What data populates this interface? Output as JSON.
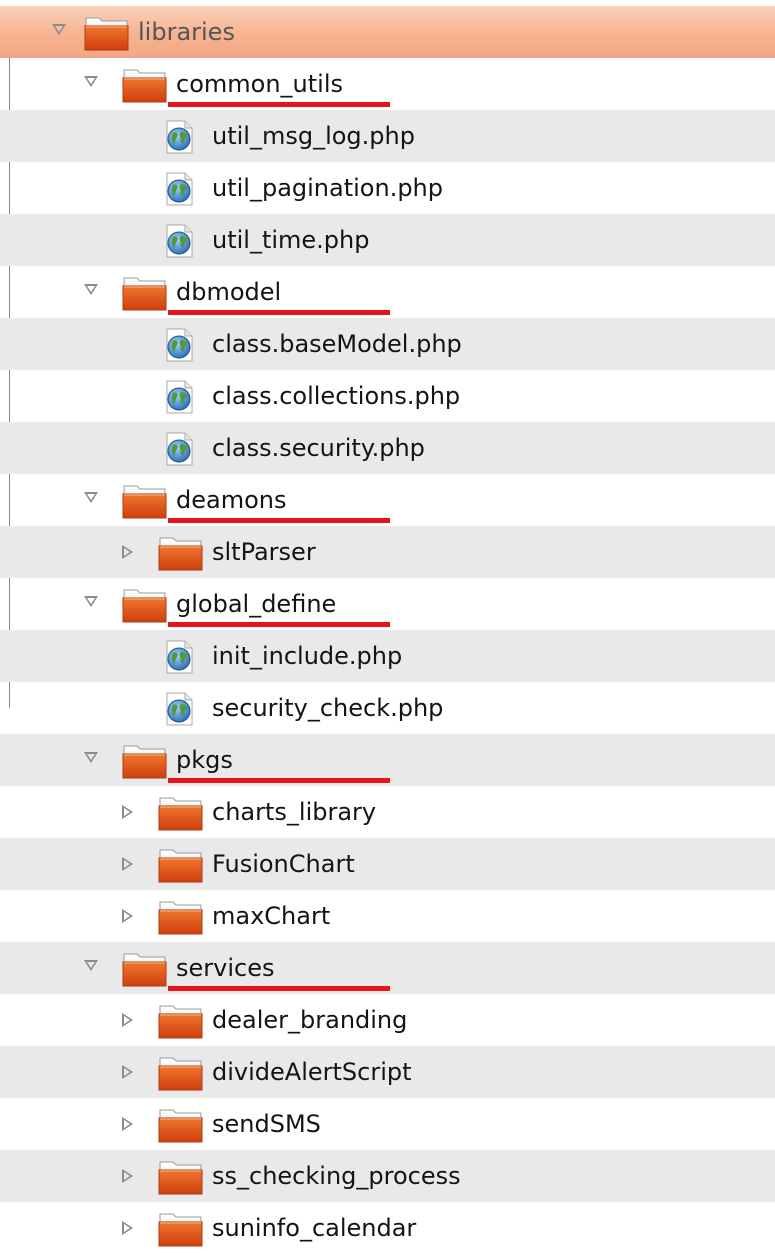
{
  "tree": [
    {
      "label": "libraries",
      "type": "folder",
      "level": 0,
      "expanded": true,
      "selected": true
    },
    {
      "label": "common_utils",
      "type": "folder",
      "level": 1,
      "expanded": true,
      "underlined": true
    },
    {
      "label": "util_msg_log.php",
      "type": "file",
      "level": 2
    },
    {
      "label": "util_pagination.php",
      "type": "file",
      "level": 2
    },
    {
      "label": "util_time.php",
      "type": "file",
      "level": 2
    },
    {
      "label": "dbmodel",
      "type": "folder",
      "level": 1,
      "expanded": true,
      "underlined": true
    },
    {
      "label": "class.baseModel.php",
      "type": "file",
      "level": 2
    },
    {
      "label": "class.collections.php",
      "type": "file",
      "level": 2
    },
    {
      "label": "class.security.php",
      "type": "file",
      "level": 2
    },
    {
      "label": "deamons",
      "type": "folder",
      "level": 1,
      "expanded": true,
      "underlined": true
    },
    {
      "label": "sltParser",
      "type": "folder",
      "level": 2,
      "expanded": false
    },
    {
      "label": "global_define",
      "type": "folder",
      "level": 1,
      "expanded": true,
      "underlined": true
    },
    {
      "label": "init_include.php",
      "type": "file",
      "level": 2
    },
    {
      "label": "security_check.php",
      "type": "file",
      "level": 2
    },
    {
      "label": "pkgs",
      "type": "folder",
      "level": 1,
      "expanded": true,
      "underlined": true
    },
    {
      "label": "charts_library",
      "type": "folder",
      "level": 2,
      "expanded": false
    },
    {
      "label": "FusionChart",
      "type": "folder",
      "level": 2,
      "expanded": false
    },
    {
      "label": "maxChart",
      "type": "folder",
      "level": 2,
      "expanded": false
    },
    {
      "label": "services",
      "type": "folder",
      "level": 1,
      "expanded": true,
      "underlined": true
    },
    {
      "label": "dealer_branding",
      "type": "folder",
      "level": 2,
      "expanded": false
    },
    {
      "label": "divideAlertScript",
      "type": "folder",
      "level": 2,
      "expanded": false
    },
    {
      "label": "sendSMS",
      "type": "folder",
      "level": 2,
      "expanded": false
    },
    {
      "label": "ss_checking_process",
      "type": "folder",
      "level": 2,
      "expanded": false
    },
    {
      "label": "suninfo_calendar",
      "type": "folder",
      "level": 2,
      "expanded": false
    }
  ],
  "colors": {
    "selection": "#f6b391",
    "row_shade": "#e9e9e9",
    "folder_orange": "#e5561a",
    "annotation_red": "#e8141a"
  },
  "icons": {
    "folder": "folder-icon",
    "file": "php-globe-icon",
    "expanded": "triangle-down-icon",
    "collapsed": "triangle-right-icon"
  }
}
